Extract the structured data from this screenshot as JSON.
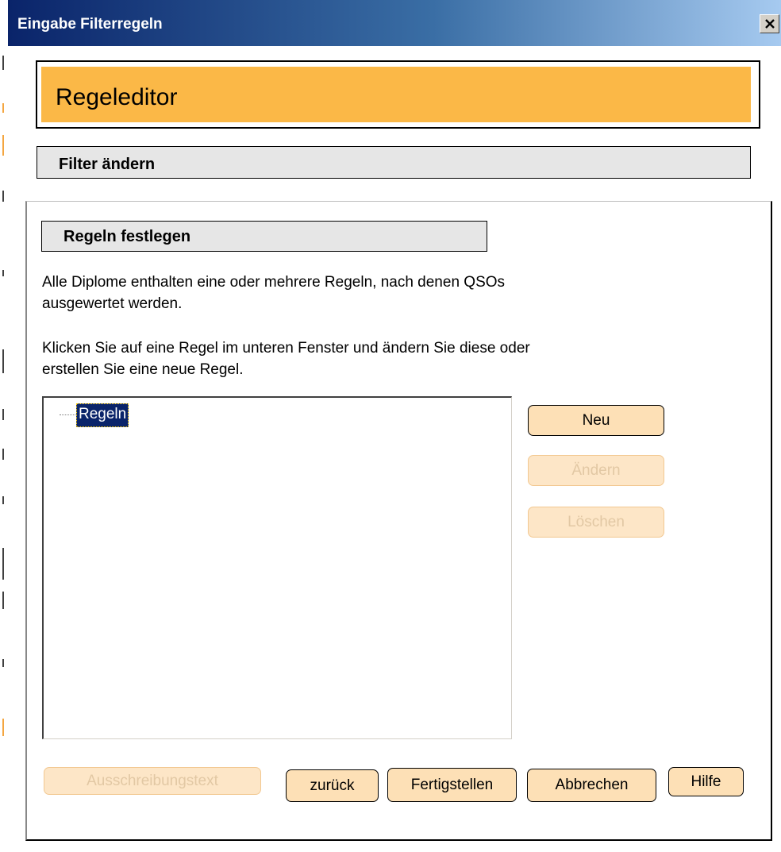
{
  "window": {
    "title": "Eingabe Filterregeln",
    "close_symbol": "×"
  },
  "header": {
    "title": "Regeleditor"
  },
  "section": {
    "title": "Filter ändern"
  },
  "subsection": {
    "title": "Regeln festlegen"
  },
  "description": {
    "line1a": "Alle Diplome enthalten eine oder mehrere Regeln, nach denen QSOs",
    "line1b": "ausgewertet werden.",
    "line2a": "Klicken Sie auf eine Regel im unteren Fenster und ändern Sie diese oder",
    "line2b": "erstellen Sie eine neue Regel."
  },
  "tree": {
    "root_label": "Regeln"
  },
  "side_buttons": {
    "new": "Neu",
    "edit": "Ändern",
    "delete": "Löschen"
  },
  "footer_buttons": {
    "announcement": "Ausschreibungstext",
    "back": "zurück",
    "finish": "Fertigstellen",
    "cancel": "Abbrechen",
    "help": "Hilfe"
  },
  "colors": {
    "accent": "#fbb847",
    "titlebar": "#0a246a",
    "button": "#fde0b6"
  }
}
